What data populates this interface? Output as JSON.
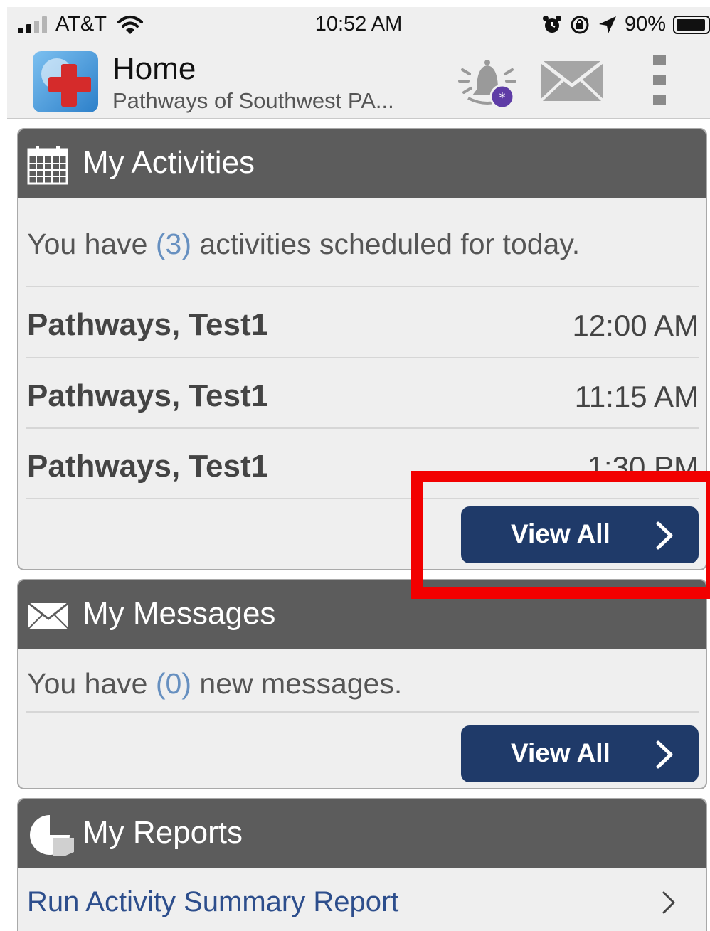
{
  "status_bar": {
    "carrier": "AT&T",
    "time": "10:52 AM",
    "battery_percent": "90%",
    "battery_level": 0.9,
    "icons": [
      "signal-icon",
      "wifi-icon",
      "alarm-icon",
      "rotation-lock-icon",
      "location-icon",
      "battery-icon"
    ]
  },
  "header": {
    "title": "Home",
    "subtitle": "Pathways of Southwest PA...",
    "icons": [
      "app-logo",
      "notification-bell-icon",
      "envelope-icon",
      "more-vertical-icon"
    ]
  },
  "activities": {
    "title": "My Activities",
    "summary_prefix": "You have ",
    "count": "(3)",
    "summary_suffix": " activities scheduled for today.",
    "items": [
      {
        "name": "Pathways, Test1",
        "time": "12:00 AM"
      },
      {
        "name": "Pathways, Test1",
        "time": "11:15 AM"
      },
      {
        "name": "Pathways, Test1",
        "time": "1:30 PM"
      }
    ],
    "view_all_label": "View All"
  },
  "messages": {
    "title": "My Messages",
    "summary_prefix": "You have ",
    "count": "(0)",
    "summary_suffix": " new messages.",
    "view_all_label": "View All"
  },
  "reports": {
    "title": "My Reports",
    "items": [
      {
        "label": "Run Activity Summary Report"
      }
    ]
  },
  "colors": {
    "card_header": "#5c5c5c",
    "button": "#1f3a69",
    "count_accent": "#6790c0",
    "link": "#2d4e8c",
    "highlight": "#f20000"
  }
}
